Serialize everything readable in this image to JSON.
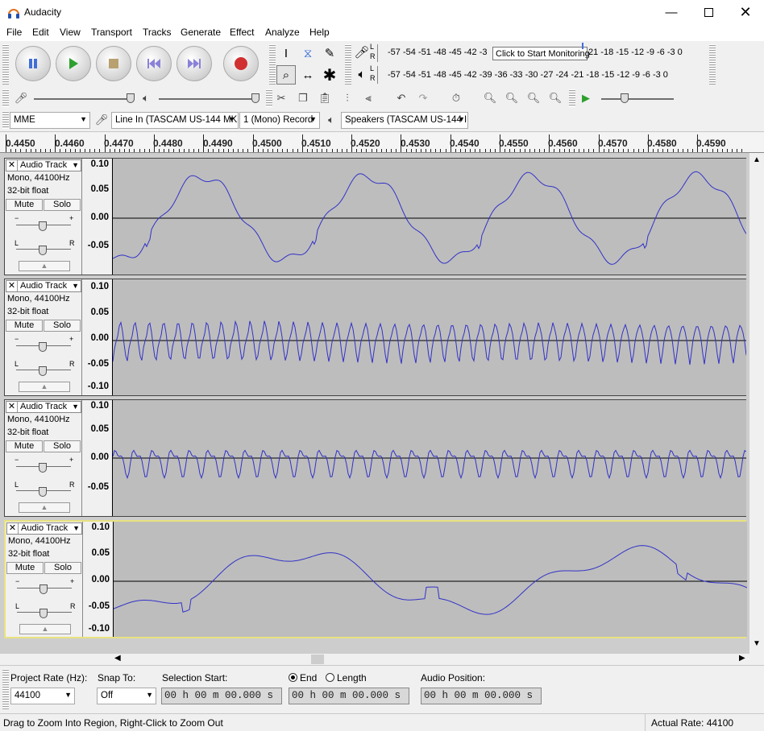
{
  "window": {
    "title": "Audacity",
    "controls": [
      "minimize-icon",
      "maximize-icon",
      "close-icon"
    ]
  },
  "menu": [
    "File",
    "Edit",
    "View",
    "Transport",
    "Tracks",
    "Generate",
    "Effect",
    "Analyze",
    "Help"
  ],
  "transport": {
    "buttons": [
      "Pause",
      "Play",
      "Stop",
      "Skip to Start",
      "Skip to End",
      "Record"
    ]
  },
  "meters": {
    "record_scale": "-57 -54 -51 -48 -45 -42 -3",
    "record_scale_tail": "21 -18 -15 -12  -9  -6  -3  0",
    "tooltip": "Click to Start Monitoring",
    "playback_scale": "-57 -54 -51 -48 -45 -42 -39 -36 -33 -30 -27 -24 -21 -18 -15 -12  -9  -6  -3  0",
    "channel_l": "L",
    "channel_r": "R"
  },
  "device": {
    "host": "MME",
    "input": "Line In (TASCAM US-144 MK",
    "channels": "1 (Mono) Record",
    "output": "Speakers (TASCAM US-144 I"
  },
  "ruler": {
    "labels": [
      "0.4450",
      "0.4460",
      "0.4470",
      "0.4480",
      "0.4490",
      "0.4500",
      "0.4510",
      "0.4520",
      "0.4530",
      "0.4540",
      "0.4550",
      "0.4560",
      "0.4570",
      "0.4580",
      "0.4590"
    ]
  },
  "tracks": [
    {
      "name": "Audio Track",
      "format": "Mono, 44100Hz",
      "bits": "32-bit float",
      "mute": "Mute",
      "solo": "Solo",
      "scale": [
        "0.10",
        "0.05",
        "0.00",
        "-0.05"
      ]
    },
    {
      "name": "Audio Track",
      "format": "Mono, 44100Hz",
      "bits": "32-bit float",
      "mute": "Mute",
      "solo": "Solo",
      "scale": [
        "0.10",
        "0.05",
        "0.00",
        "-0.05",
        "-0.10"
      ]
    },
    {
      "name": "Audio Track",
      "format": "Mono, 44100Hz",
      "bits": "32-bit float",
      "mute": "Mute",
      "solo": "Solo",
      "scale": [
        "0.10",
        "0.05",
        "0.00",
        "-0.05"
      ]
    },
    {
      "name": "Audio Track",
      "format": "Mono, 44100Hz",
      "bits": "32-bit float",
      "mute": "Mute",
      "solo": "Solo",
      "scale": [
        "0.10",
        "0.05",
        "0.00",
        "-0.05",
        "-0.10"
      ]
    }
  ],
  "track_mini": {
    "minus": "−",
    "plus": "+",
    "left": "L",
    "right": "R"
  },
  "selection": {
    "project_rate_label": "Project Rate (Hz):",
    "project_rate": "44100",
    "snap_label": "Snap To:",
    "snap_value": "Off",
    "start_label": "Selection Start:",
    "end_label": "End",
    "length_label": "Length",
    "position_label": "Audio Position:",
    "start_time": "00 h 00 m 00.000 s",
    "end_time": "00 h 00 m 00.000 s",
    "position_time": "00 h 00 m 00.000 s"
  },
  "status": {
    "hint": "Drag to Zoom Into Region, Right-Click to Zoom Out",
    "actual_rate": "Actual Rate: 44100"
  },
  "colors": {
    "waveform": "#3232c8",
    "wave_bg": "#bdbdbd",
    "selected_track_border": "#e8e280",
    "record_red": "#d03030",
    "play_green": "#2ea02e",
    "pause_blue": "#3f6fd8"
  }
}
